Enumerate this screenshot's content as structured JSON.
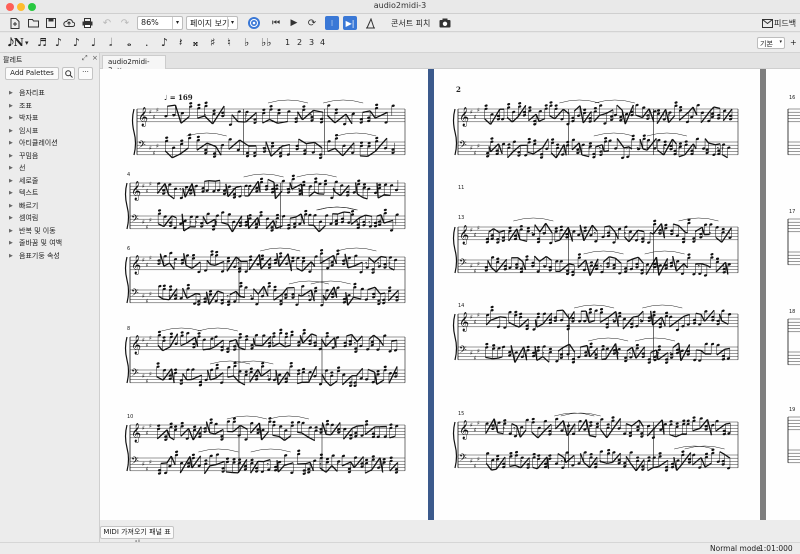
{
  "window": {
    "title": "audio2midi-3"
  },
  "toolbar": {
    "zoom": "86%",
    "view_mode": "페이지 보기",
    "concert_pitch": "콘서트 피치",
    "feedback": "피드백"
  },
  "note_input": {
    "voices": [
      "1",
      "2",
      "3",
      "4"
    ],
    "layout": "기본"
  },
  "palette": {
    "title": "팔레트",
    "add_button": "Add Palettes",
    "items": [
      "음자리표",
      "조표",
      "박자표",
      "임시표",
      "아티큘레이션",
      "꾸밈음",
      "선",
      "세로줄",
      "텍스트",
      "빠르기",
      "셈여림",
      "반복 및 이동",
      "줄바꿈 및 여백",
      "음표기둥 속성"
    ]
  },
  "tabs": [
    {
      "label": "audio2midi-3"
    }
  ],
  "score": {
    "tempo_marking": "♩ = 169",
    "page2_number": "2",
    "left_page_measures": [
      "4",
      "6",
      "8",
      "10"
    ],
    "right_page_measures": [
      "11",
      "13",
      "14",
      "15"
    ],
    "edge_measures": [
      "16",
      "17",
      "18",
      "19"
    ]
  },
  "bottom": {
    "midi_panel_button": "MIDI 가져오기 패널 표시"
  },
  "status": {
    "mode": "Normal mode",
    "time": "1:01:000"
  },
  "icons": [
    "new-file-icon",
    "open-folder-icon",
    "save-icon",
    "cloud-upload-icon",
    "print-icon",
    "undo-icon",
    "redo-icon",
    "metronome-icon",
    "rewind-icon",
    "play-icon",
    "loop-icon",
    "playback-settings-icon",
    "tuning-icon",
    "screenshot-icon",
    "feedback-icon"
  ]
}
